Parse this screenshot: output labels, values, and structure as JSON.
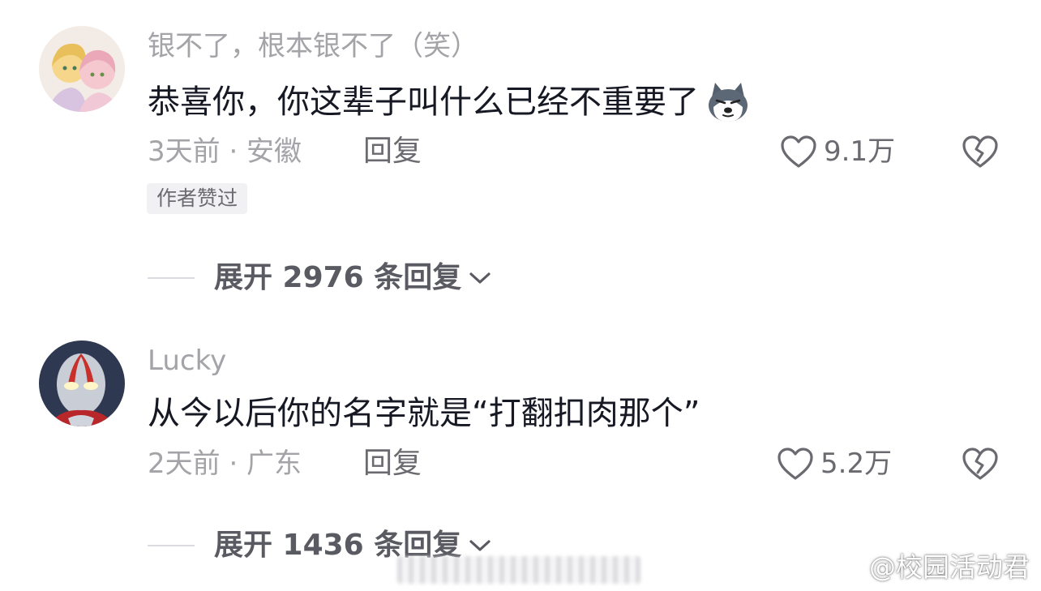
{
  "comments": [
    {
      "username": "银不了，根本银不了（笑）",
      "content": "恭喜你，你这辈子叫什么已经不重要了",
      "emoji": "husky-dog-emoji",
      "meta": "3天前 · 安徽",
      "reply_label": "回复",
      "likes": "9.1万",
      "badge": "作者赞过",
      "expand_label": "展开 2976 条回复"
    },
    {
      "username": "Lucky",
      "content": "从今以后你的名字就是“打翻扣肉那个”",
      "meta": "2天前 · 广东",
      "reply_label": "回复",
      "likes": "5.2万",
      "expand_label": "展开 1436 条回复"
    }
  ],
  "watermark": "@校园活动君",
  "colors": {
    "text_primary": "#161823",
    "text_secondary": "#a3a3a8",
    "text_action": "#6a6a70",
    "badge_bg": "#f1f1f3"
  },
  "icons": [
    "heart-outline-icon",
    "broken-heart-icon",
    "chevron-down-icon",
    "weibo-logo-icon"
  ]
}
